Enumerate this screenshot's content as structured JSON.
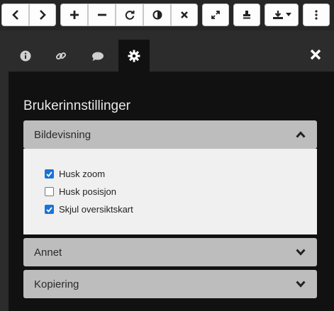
{
  "toolbar": {
    "buttons": [
      {
        "name": "previous-button",
        "icon": "chevron-left-icon"
      },
      {
        "name": "next-button",
        "icon": "chevron-right-icon"
      },
      {
        "name": "zoom-in-button",
        "icon": "plus-icon"
      },
      {
        "name": "zoom-out-button",
        "icon": "minus-icon"
      },
      {
        "name": "rotate-button",
        "icon": "rotate-icon"
      },
      {
        "name": "contrast-button",
        "icon": "contrast-icon"
      },
      {
        "name": "reset-button",
        "icon": "close-icon"
      },
      {
        "name": "fullscreen-button",
        "icon": "expand-icon"
      },
      {
        "name": "stamp-button",
        "icon": "stamp-icon"
      },
      {
        "name": "download-button",
        "icon": "download-icon"
      },
      {
        "name": "more-button",
        "icon": "vertical-dots-icon"
      }
    ]
  },
  "tabs": [
    {
      "name": "tab-info",
      "icon": "info-icon",
      "active": false
    },
    {
      "name": "tab-link",
      "icon": "link-icon",
      "active": false
    },
    {
      "name": "tab-comments",
      "icon": "comment-icon",
      "active": false
    },
    {
      "name": "tab-settings",
      "icon": "gear-icon",
      "active": true
    }
  ],
  "settings": {
    "title": "Brukerinnstillinger",
    "sections": [
      {
        "label": "Bildevisning",
        "expanded": true,
        "options": [
          {
            "label": "Husk zoom",
            "checked": true
          },
          {
            "label": "Husk posisjon",
            "checked": false
          },
          {
            "label": "Skjul oversiktskart",
            "checked": true
          }
        ]
      },
      {
        "label": "Annet",
        "expanded": false
      },
      {
        "label": "Kopiering",
        "expanded": false
      }
    ]
  },
  "colors": {
    "checkbox_accent": "#1a73d8",
    "accordion_header": "#bdbdbd",
    "panel_bg": "#111111"
  }
}
